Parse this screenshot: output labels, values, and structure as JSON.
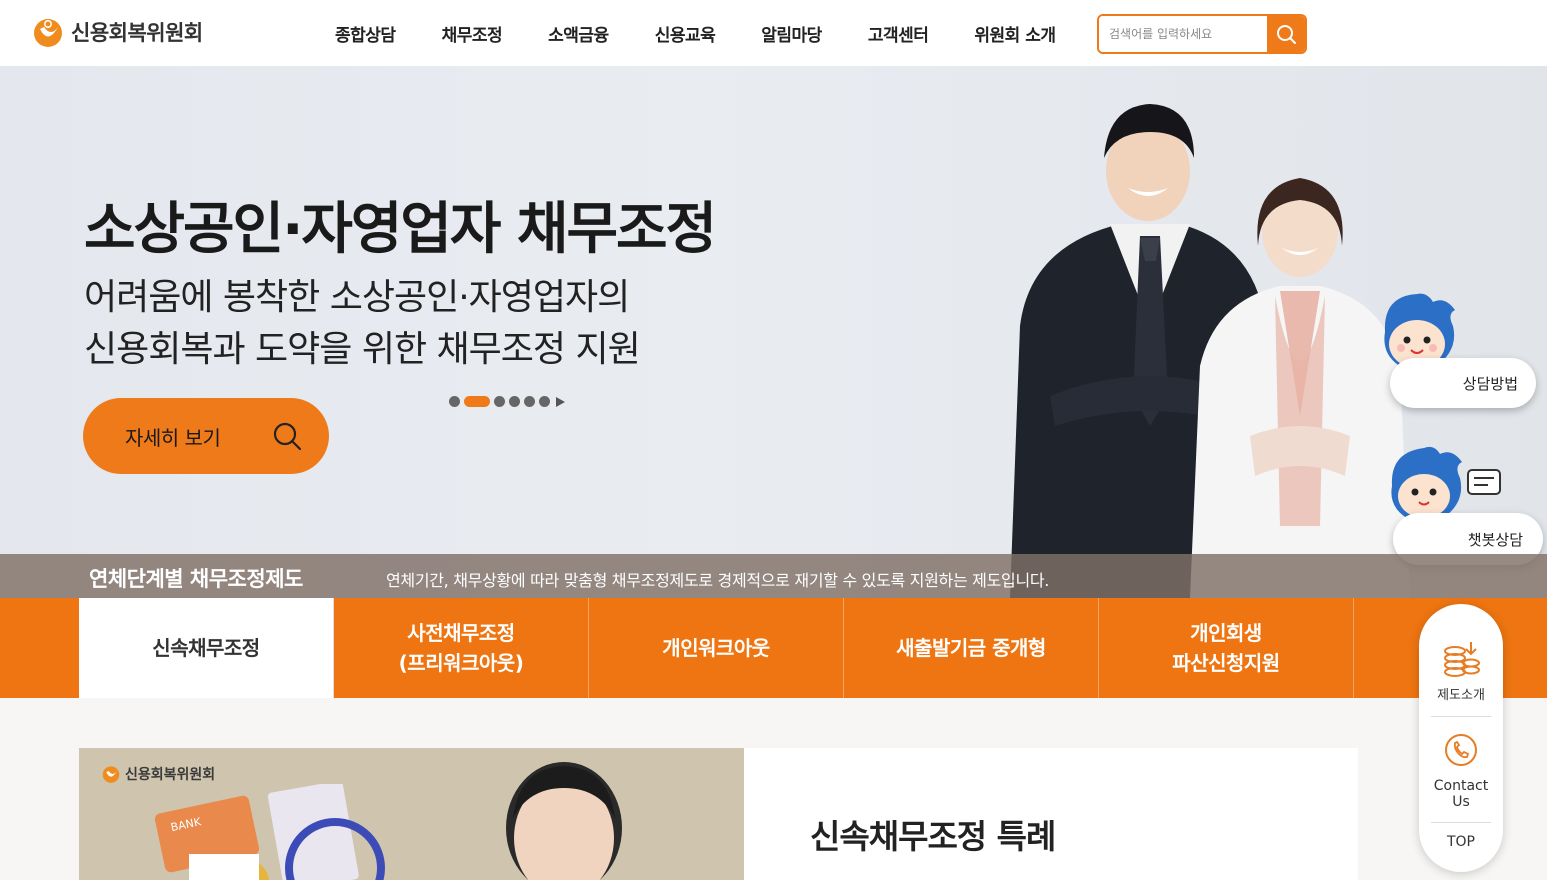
{
  "header": {
    "logo_text": "신용회복위원회",
    "nav": [
      "종합상담",
      "채무조정",
      "소액금융",
      "신용교육",
      "알림마당",
      "고객센터",
      "위원회 소개"
    ],
    "search_placeholder": "검색어를 입력하세요"
  },
  "hero": {
    "title": "소상공인·자영업자 채무조정",
    "subtitle_line1": "어려움에 봉착한 소상공인·자영업자의",
    "subtitle_line2": "신용회복과 도약을 위한 채무조정 지원",
    "button_label": "자세히 보기",
    "slides_total": 6,
    "slide_active": 2
  },
  "band": {
    "title": "연체단계별 채무조정제도",
    "desc": "연체기간, 채무상황에 따라 맞춤형 채무조정제도로 경제적으로 재기할 수 있도록 지원하는 제도입니다."
  },
  "tabs": [
    {
      "label": "신속채무조정",
      "active": true
    },
    {
      "label": "사전채무조정\n(프리워크아웃)",
      "active": false
    },
    {
      "label": "개인워크아웃",
      "active": false
    },
    {
      "label": "새출발기금 중개형",
      "active": false
    },
    {
      "label": "개인회생\n파산신청지원",
      "active": false
    }
  ],
  "content": {
    "thumb_logo": "신용회복위원회",
    "thumb_card_text": "BANK",
    "info_title": "신속채무조정 특례"
  },
  "floating": {
    "consult_method": "상담방법",
    "chatbot": "챗봇상담"
  },
  "quick_menu": {
    "item1": "제도소개",
    "item2": "Contact Us",
    "top": "TOP"
  },
  "colors": {
    "accent": "#ef7a1a",
    "tab_bg": "#ee7511",
    "band_bg": "#807066"
  }
}
